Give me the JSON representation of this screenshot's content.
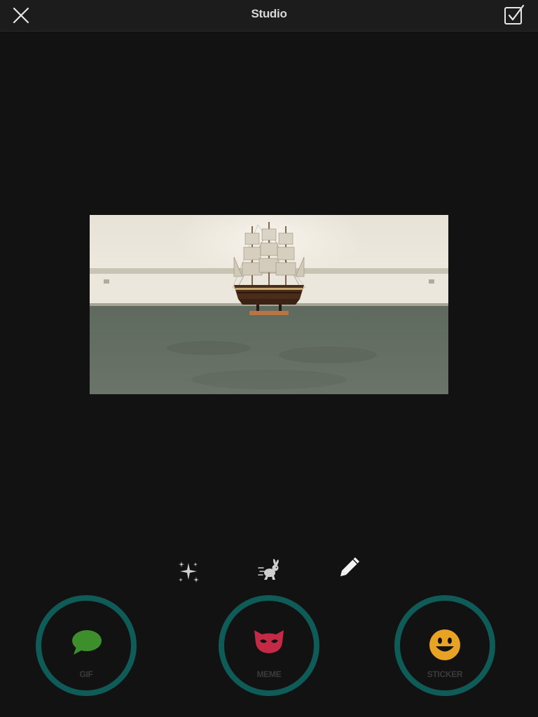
{
  "nav": {
    "title": "Studio",
    "close_icon": "close-icon",
    "done_icon": "checkbox-checked-icon"
  },
  "tools": [
    {
      "name": "effects",
      "icon": "sparkles-icon"
    },
    {
      "name": "speed",
      "icon": "rabbit-icon"
    },
    {
      "name": "draw",
      "icon": "pencil-icon"
    }
  ],
  "modes": [
    {
      "label": "GIF",
      "icon": "speech-bubble-icon",
      "color": "#3d8f2c"
    },
    {
      "label": "MEME",
      "icon": "mask-icon",
      "color": "#c42a45"
    },
    {
      "label": "STICKER",
      "icon": "smiley-icon",
      "color": "#e8a324"
    }
  ],
  "colors": {
    "background": "#121212",
    "navbar": "#1c1c1c",
    "ring": "#0e5b57",
    "mode_label": "#3b3b3b"
  }
}
